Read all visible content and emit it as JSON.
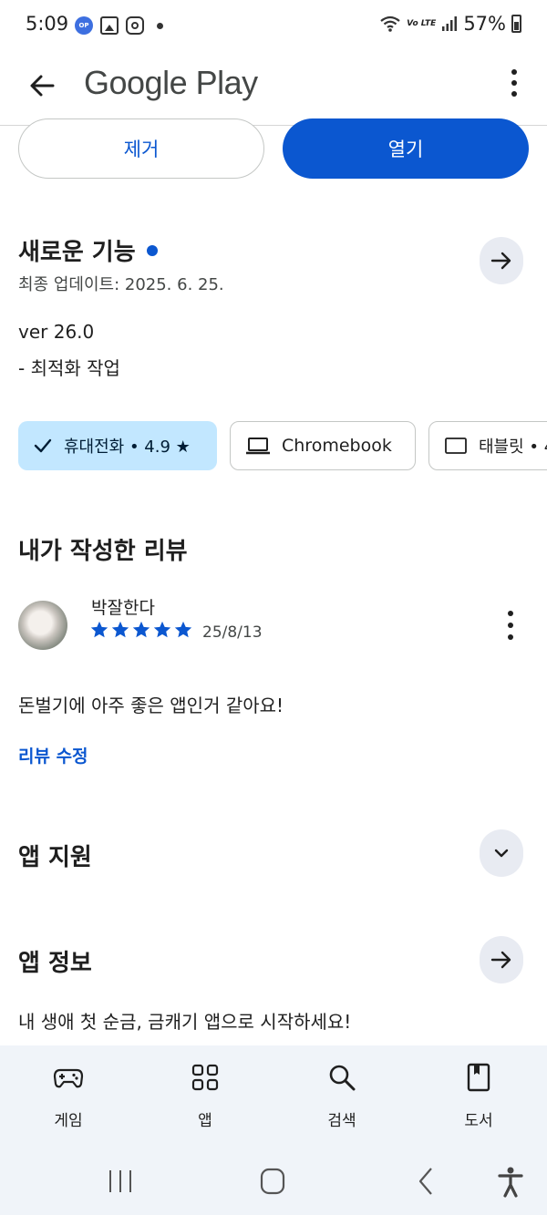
{
  "status": {
    "time": "5:09",
    "battery": "57%",
    "lte": "Vo LTE",
    "icons": [
      "opgg-icon",
      "gallery-icon",
      "instagram-icon",
      "dot-icon",
      "wifi-icon",
      "signal-icon",
      "battery-icon"
    ]
  },
  "app_bar": {
    "title": "Google Play"
  },
  "actions": {
    "remove": "제거",
    "open": "열기"
  },
  "whats_new": {
    "title": "새로운 기능",
    "updated": "최종 업데이트: 2025. 6. 25.",
    "version": "ver 26.0",
    "notes": "- 최적화 작업"
  },
  "chips": {
    "phone": "휴대전화 • 4.9 ★",
    "chromebook": "Chromebook",
    "tablet": "태블릿 • 4"
  },
  "my_review": {
    "title": "내가 작성한 리뷰",
    "reviewer": "박잘한다",
    "rating": 5,
    "date": "25/8/13",
    "text": "돈벌기에 아주 좋은 앱인거 같아요!",
    "edit": "리뷰 수정"
  },
  "app_support": {
    "title": "앱 지원"
  },
  "about": {
    "title": "앱 정보",
    "description": "내 생애 첫 순금, 금캐기 앱으로 시작하세요!"
  },
  "bottom_nav": [
    {
      "label": "게임",
      "icon": "gamepad-icon"
    },
    {
      "label": "앱",
      "icon": "apps-grid-icon"
    },
    {
      "label": "검색",
      "icon": "search-icon"
    },
    {
      "label": "도서",
      "icon": "book-icon"
    }
  ],
  "colors": {
    "primary": "#0b57d0",
    "chip_selected": "#c2e7ff",
    "round_button": "#e8ebf2",
    "nav_bg": "#f0f4f9"
  }
}
